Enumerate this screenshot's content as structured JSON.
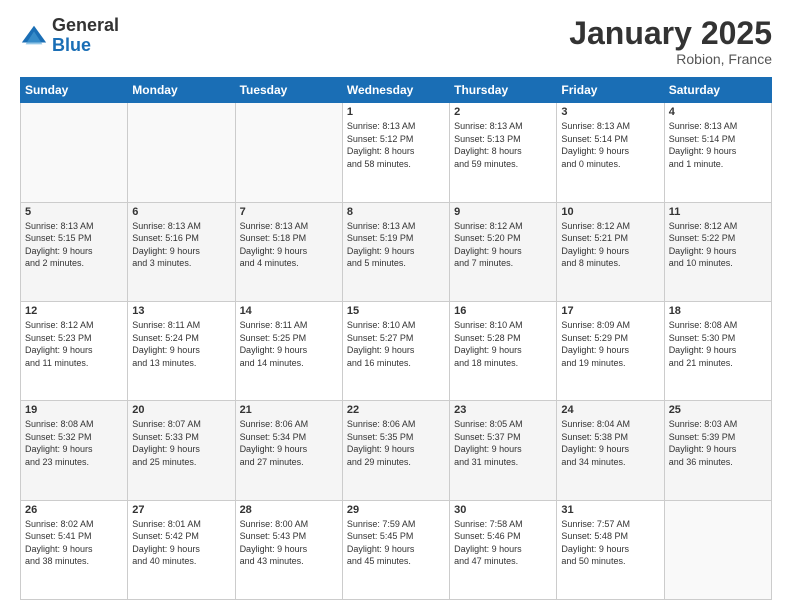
{
  "logo": {
    "general": "General",
    "blue": "Blue"
  },
  "header": {
    "month": "January 2025",
    "location": "Robion, France"
  },
  "weekdays": [
    "Sunday",
    "Monday",
    "Tuesday",
    "Wednesday",
    "Thursday",
    "Friday",
    "Saturday"
  ],
  "weeks": [
    [
      {
        "day": "",
        "info": ""
      },
      {
        "day": "",
        "info": ""
      },
      {
        "day": "",
        "info": ""
      },
      {
        "day": "1",
        "info": "Sunrise: 8:13 AM\nSunset: 5:12 PM\nDaylight: 8 hours\nand 58 minutes."
      },
      {
        "day": "2",
        "info": "Sunrise: 8:13 AM\nSunset: 5:13 PM\nDaylight: 8 hours\nand 59 minutes."
      },
      {
        "day": "3",
        "info": "Sunrise: 8:13 AM\nSunset: 5:14 PM\nDaylight: 9 hours\nand 0 minutes."
      },
      {
        "day": "4",
        "info": "Sunrise: 8:13 AM\nSunset: 5:14 PM\nDaylight: 9 hours\nand 1 minute."
      }
    ],
    [
      {
        "day": "5",
        "info": "Sunrise: 8:13 AM\nSunset: 5:15 PM\nDaylight: 9 hours\nand 2 minutes."
      },
      {
        "day": "6",
        "info": "Sunrise: 8:13 AM\nSunset: 5:16 PM\nDaylight: 9 hours\nand 3 minutes."
      },
      {
        "day": "7",
        "info": "Sunrise: 8:13 AM\nSunset: 5:18 PM\nDaylight: 9 hours\nand 4 minutes."
      },
      {
        "day": "8",
        "info": "Sunrise: 8:13 AM\nSunset: 5:19 PM\nDaylight: 9 hours\nand 5 minutes."
      },
      {
        "day": "9",
        "info": "Sunrise: 8:12 AM\nSunset: 5:20 PM\nDaylight: 9 hours\nand 7 minutes."
      },
      {
        "day": "10",
        "info": "Sunrise: 8:12 AM\nSunset: 5:21 PM\nDaylight: 9 hours\nand 8 minutes."
      },
      {
        "day": "11",
        "info": "Sunrise: 8:12 AM\nSunset: 5:22 PM\nDaylight: 9 hours\nand 10 minutes."
      }
    ],
    [
      {
        "day": "12",
        "info": "Sunrise: 8:12 AM\nSunset: 5:23 PM\nDaylight: 9 hours\nand 11 minutes."
      },
      {
        "day": "13",
        "info": "Sunrise: 8:11 AM\nSunset: 5:24 PM\nDaylight: 9 hours\nand 13 minutes."
      },
      {
        "day": "14",
        "info": "Sunrise: 8:11 AM\nSunset: 5:25 PM\nDaylight: 9 hours\nand 14 minutes."
      },
      {
        "day": "15",
        "info": "Sunrise: 8:10 AM\nSunset: 5:27 PM\nDaylight: 9 hours\nand 16 minutes."
      },
      {
        "day": "16",
        "info": "Sunrise: 8:10 AM\nSunset: 5:28 PM\nDaylight: 9 hours\nand 18 minutes."
      },
      {
        "day": "17",
        "info": "Sunrise: 8:09 AM\nSunset: 5:29 PM\nDaylight: 9 hours\nand 19 minutes."
      },
      {
        "day": "18",
        "info": "Sunrise: 8:08 AM\nSunset: 5:30 PM\nDaylight: 9 hours\nand 21 minutes."
      }
    ],
    [
      {
        "day": "19",
        "info": "Sunrise: 8:08 AM\nSunset: 5:32 PM\nDaylight: 9 hours\nand 23 minutes."
      },
      {
        "day": "20",
        "info": "Sunrise: 8:07 AM\nSunset: 5:33 PM\nDaylight: 9 hours\nand 25 minutes."
      },
      {
        "day": "21",
        "info": "Sunrise: 8:06 AM\nSunset: 5:34 PM\nDaylight: 9 hours\nand 27 minutes."
      },
      {
        "day": "22",
        "info": "Sunrise: 8:06 AM\nSunset: 5:35 PM\nDaylight: 9 hours\nand 29 minutes."
      },
      {
        "day": "23",
        "info": "Sunrise: 8:05 AM\nSunset: 5:37 PM\nDaylight: 9 hours\nand 31 minutes."
      },
      {
        "day": "24",
        "info": "Sunrise: 8:04 AM\nSunset: 5:38 PM\nDaylight: 9 hours\nand 34 minutes."
      },
      {
        "day": "25",
        "info": "Sunrise: 8:03 AM\nSunset: 5:39 PM\nDaylight: 9 hours\nand 36 minutes."
      }
    ],
    [
      {
        "day": "26",
        "info": "Sunrise: 8:02 AM\nSunset: 5:41 PM\nDaylight: 9 hours\nand 38 minutes."
      },
      {
        "day": "27",
        "info": "Sunrise: 8:01 AM\nSunset: 5:42 PM\nDaylight: 9 hours\nand 40 minutes."
      },
      {
        "day": "28",
        "info": "Sunrise: 8:00 AM\nSunset: 5:43 PM\nDaylight: 9 hours\nand 43 minutes."
      },
      {
        "day": "29",
        "info": "Sunrise: 7:59 AM\nSunset: 5:45 PM\nDaylight: 9 hours\nand 45 minutes."
      },
      {
        "day": "30",
        "info": "Sunrise: 7:58 AM\nSunset: 5:46 PM\nDaylight: 9 hours\nand 47 minutes."
      },
      {
        "day": "31",
        "info": "Sunrise: 7:57 AM\nSunset: 5:48 PM\nDaylight: 9 hours\nand 50 minutes."
      },
      {
        "day": "",
        "info": ""
      }
    ]
  ]
}
